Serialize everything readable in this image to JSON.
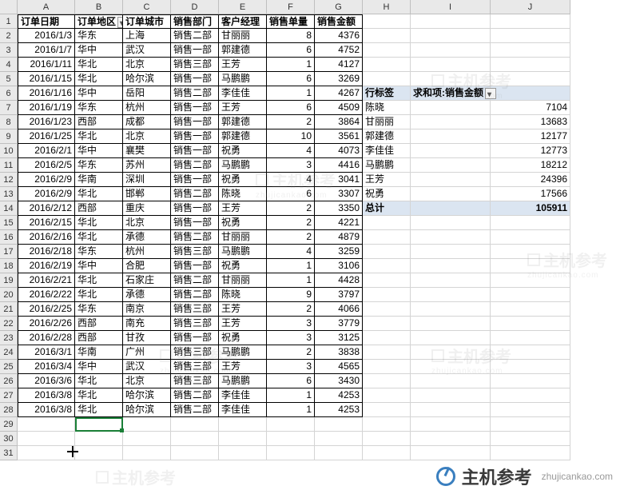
{
  "columns": [
    "A",
    "B",
    "C",
    "D",
    "E",
    "F",
    "G",
    "H",
    "I",
    "J"
  ],
  "row_start": 1,
  "row_end": 31,
  "headers": {
    "A": "订单日期",
    "B": "订单地区",
    "C": "订单城市",
    "D": "销售部门",
    "E": "客户经理",
    "F": "销售单量",
    "G": "销售金额"
  },
  "rows": [
    {
      "A": "2016/1/3",
      "B": "华东",
      "C": "上海",
      "D": "销售二部",
      "E": "甘丽丽",
      "F": 8,
      "G": 4376
    },
    {
      "A": "2016/1/7",
      "B": "华中",
      "C": "武汉",
      "D": "销售一部",
      "E": "郭建德",
      "F": 6,
      "G": 4752
    },
    {
      "A": "2016/1/11",
      "B": "华北",
      "C": "北京",
      "D": "销售三部",
      "E": "王芳",
      "F": 1,
      "G": 4127
    },
    {
      "A": "2016/1/15",
      "B": "华北",
      "C": "哈尔滨",
      "D": "销售一部",
      "E": "马鹏鹏",
      "F": 6,
      "G": 3269
    },
    {
      "A": "2016/1/16",
      "B": "华中",
      "C": "岳阳",
      "D": "销售二部",
      "E": "李佳佳",
      "F": 1,
      "G": 4267
    },
    {
      "A": "2016/1/19",
      "B": "华东",
      "C": "杭州",
      "D": "销售一部",
      "E": "王芳",
      "F": 6,
      "G": 4509
    },
    {
      "A": "2016/1/23",
      "B": "西部",
      "C": "成都",
      "D": "销售一部",
      "E": "郭建德",
      "F": 2,
      "G": 3864
    },
    {
      "A": "2016/1/25",
      "B": "华北",
      "C": "北京",
      "D": "销售一部",
      "E": "郭建德",
      "F": 10,
      "G": 3561
    },
    {
      "A": "2016/2/1",
      "B": "华中",
      "C": "襄樊",
      "D": "销售一部",
      "E": "祝勇",
      "F": 4,
      "G": 4073
    },
    {
      "A": "2016/2/5",
      "B": "华东",
      "C": "苏州",
      "D": "销售二部",
      "E": "马鹏鹏",
      "F": 3,
      "G": 4416
    },
    {
      "A": "2016/2/9",
      "B": "华南",
      "C": "深圳",
      "D": "销售一部",
      "E": "祝勇",
      "F": 4,
      "G": 3041
    },
    {
      "A": "2016/2/9",
      "B": "华北",
      "C": "邯郸",
      "D": "销售二部",
      "E": "陈晓",
      "F": 6,
      "G": 3307
    },
    {
      "A": "2016/2/12",
      "B": "西部",
      "C": "重庆",
      "D": "销售一部",
      "E": "王芳",
      "F": 2,
      "G": 3350
    },
    {
      "A": "2016/2/15",
      "B": "华北",
      "C": "北京",
      "D": "销售一部",
      "E": "祝勇",
      "F": 2,
      "G": 4221
    },
    {
      "A": "2016/2/16",
      "B": "华北",
      "C": "承德",
      "D": "销售二部",
      "E": "甘丽丽",
      "F": 2,
      "G": 4879
    },
    {
      "A": "2016/2/18",
      "B": "华东",
      "C": "杭州",
      "D": "销售三部",
      "E": "马鹏鹏",
      "F": 4,
      "G": 3259
    },
    {
      "A": "2016/2/19",
      "B": "华中",
      "C": "合肥",
      "D": "销售一部",
      "E": "祝勇",
      "F": 1,
      "G": 3106
    },
    {
      "A": "2016/2/21",
      "B": "华北",
      "C": "石家庄",
      "D": "销售二部",
      "E": "甘丽丽",
      "F": 1,
      "G": 4428
    },
    {
      "A": "2016/2/22",
      "B": "华北",
      "C": "承德",
      "D": "销售二部",
      "E": "陈晓",
      "F": 9,
      "G": 3797
    },
    {
      "A": "2016/2/25",
      "B": "华东",
      "C": "南京",
      "D": "销售三部",
      "E": "王芳",
      "F": 2,
      "G": 4066
    },
    {
      "A": "2016/2/26",
      "B": "西部",
      "C": "南充",
      "D": "销售三部",
      "E": "王芳",
      "F": 3,
      "G": 3779
    },
    {
      "A": "2016/2/28",
      "B": "西部",
      "C": "甘孜",
      "D": "销售一部",
      "E": "祝勇",
      "F": 3,
      "G": 3125
    },
    {
      "A": "2016/3/1",
      "B": "华南",
      "C": "广州",
      "D": "销售三部",
      "E": "马鹏鹏",
      "F": 2,
      "G": 3838
    },
    {
      "A": "2016/3/4",
      "B": "华中",
      "C": "武汉",
      "D": "销售三部",
      "E": "王芳",
      "F": 3,
      "G": 4565
    },
    {
      "A": "2016/3/6",
      "B": "华北",
      "C": "北京",
      "D": "销售三部",
      "E": "马鹏鹏",
      "F": 6,
      "G": 3430
    },
    {
      "A": "2016/3/8",
      "B": "华北",
      "C": "哈尔滨",
      "D": "销售二部",
      "E": "李佳佳",
      "F": 1,
      "G": 4253
    },
    {
      "A": "2016/3/8",
      "B": "华北",
      "C": "哈尔滨",
      "D": "销售二部",
      "E": "李佳佳",
      "F": 1,
      "G": 4253
    }
  ],
  "pivot": {
    "header_row_label": "行标签",
    "header_value_label": "求和项:销售金额",
    "items": [
      {
        "label": "陈晓",
        "value": 7104
      },
      {
        "label": "甘丽丽",
        "value": 13683
      },
      {
        "label": "郭建德",
        "value": 12177
      },
      {
        "label": "李佳佳",
        "value": 12773
      },
      {
        "label": "马鹏鹏",
        "value": 18212
      },
      {
        "label": "王芳",
        "value": 24396
      },
      {
        "label": "祝勇",
        "value": 17566
      }
    ],
    "total_label": "总计",
    "total_value": 105911
  },
  "brand": {
    "name": "主机参考",
    "url": "zhujicankao.com"
  },
  "chart_data": {
    "type": "table",
    "title": "求和项:销售金额 by 客户经理",
    "categories": [
      "陈晓",
      "甘丽丽",
      "郭建德",
      "李佳佳",
      "马鹏鹏",
      "王芳",
      "祝勇"
    ],
    "values": [
      7104,
      13683,
      12177,
      12773,
      18212,
      24396,
      17566
    ],
    "total": 105911
  }
}
